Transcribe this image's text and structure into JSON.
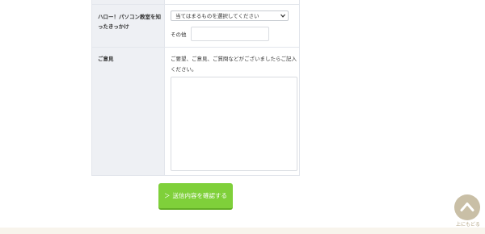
{
  "form": {
    "source": {
      "label": "ハロー！パソコン教室を知ったきっかけ",
      "select_value": "当てはまるものを選択してください",
      "other_label": "その他",
      "other_value": ""
    },
    "opinion": {
      "label": "ご意見",
      "note": "ご要望、ご意見、ご質問などがございましたらご記入ください。",
      "textarea_value": ""
    }
  },
  "submit": {
    "arrow": "＞",
    "label": "送信内容を確認する"
  },
  "page_top": {
    "label": "上にもどる",
    "icon": "chevron-up-icon"
  },
  "colors": {
    "header_cell": "#eef0f4",
    "submit_button": "#7fd03a",
    "page_top_circle": "#c9bfa6",
    "footer_band": "#f8f4ec"
  }
}
